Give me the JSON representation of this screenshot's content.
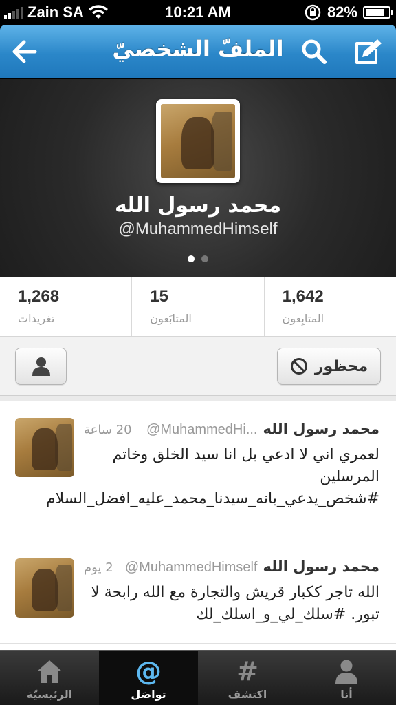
{
  "status_bar": {
    "carrier": "Zain SA",
    "time": "10:21 AM",
    "battery": "82%",
    "battery_level": 0.82
  },
  "nav": {
    "title": "الملفّ الشخصيّ"
  },
  "profile": {
    "name": "محمد رسول الله",
    "handle": "@MuhammedHimself"
  },
  "stats": [
    {
      "value": "1,268",
      "label": "تغريدات"
    },
    {
      "value": "15",
      "label": "المتابَعون"
    },
    {
      "value": "1,642",
      "label": "المتابِعون"
    }
  ],
  "actions": {
    "blocked_label": "محظور"
  },
  "tweets": [
    {
      "name": "محمد رسول الله",
      "handle": "@MuhammedHi...",
      "time": "20 ساعة",
      "text": "لعمري اني لا ادعي بل انا سيد الخلق وخاتم المرسلين #شخص_يدعي_بانه_سيدنا_محمد_عليه_افضل_السلام"
    },
    {
      "name": "محمد رسول الله",
      "handle": "@MuhammedHimself",
      "time": "2 يوم",
      "text": "الله تاجر ككبار قريش والتجارة مع الله رابحة لا تبور. #سلك_لي_و_اسلك_لك"
    }
  ],
  "tabs": [
    {
      "label": "الرئيسيّة",
      "icon": "home-icon"
    },
    {
      "label": "تواصَل",
      "icon": "at-icon"
    },
    {
      "label": "اكتشف",
      "icon": "hashtag-icon"
    },
    {
      "label": "أنا",
      "icon": "person-icon"
    }
  ],
  "colors": {
    "nav_blue": "#2b87c9",
    "active_tab_icon": "#5db8f0"
  }
}
